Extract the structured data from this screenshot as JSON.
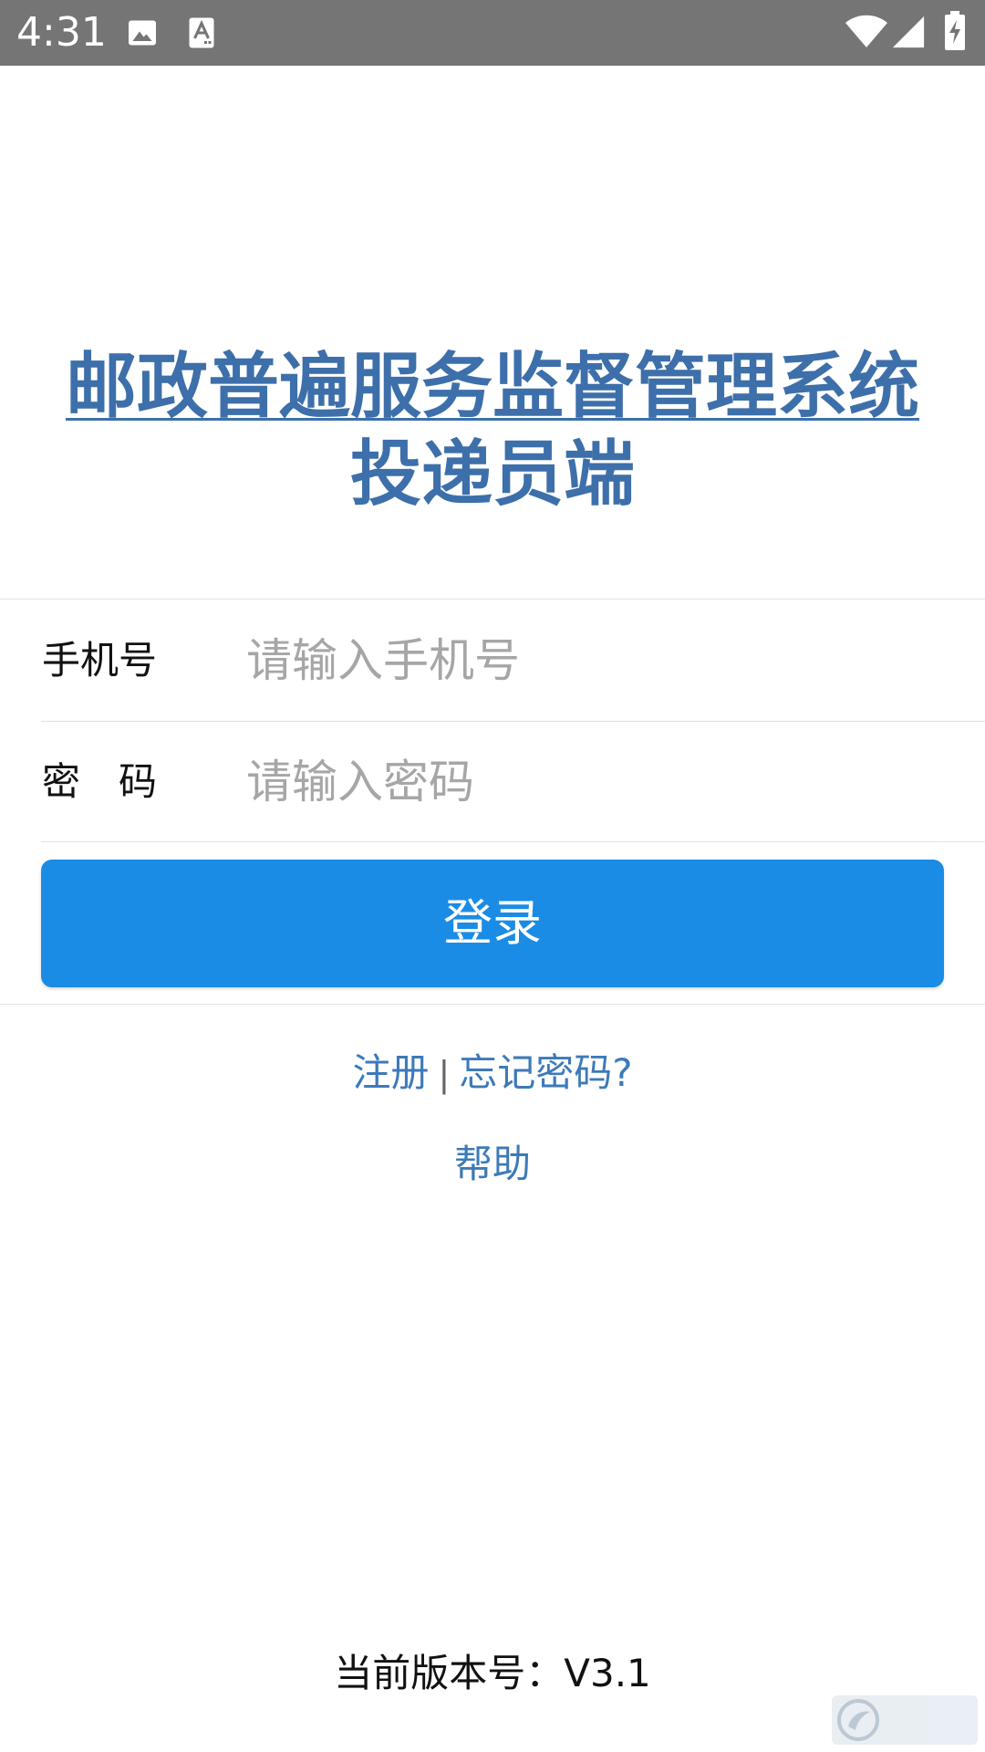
{
  "status_bar": {
    "time": "4:31",
    "icons": [
      "image-icon",
      "text-a-icon",
      "wifi-icon",
      "signal-icon",
      "battery-charging-icon"
    ]
  },
  "title": {
    "line1": "邮政普遍服务监督管理系统",
    "line2": "投递员端",
    "color": "#3d6faa"
  },
  "form": {
    "phone": {
      "label": "手机号",
      "placeholder": "请输入手机号",
      "value": ""
    },
    "password": {
      "label": "密　码",
      "placeholder": "请输入密码",
      "value": ""
    },
    "login_label": "登录",
    "login_color": "#1a8ce6"
  },
  "links": {
    "register": "注册",
    "separator": "|",
    "forgot": "忘记密码?",
    "help": "帮助",
    "color": "#3d7ab8"
  },
  "footer": {
    "version": "当前版本号：V3.1"
  },
  "watermark": {
    "icon": "watermark-logo-icon"
  }
}
